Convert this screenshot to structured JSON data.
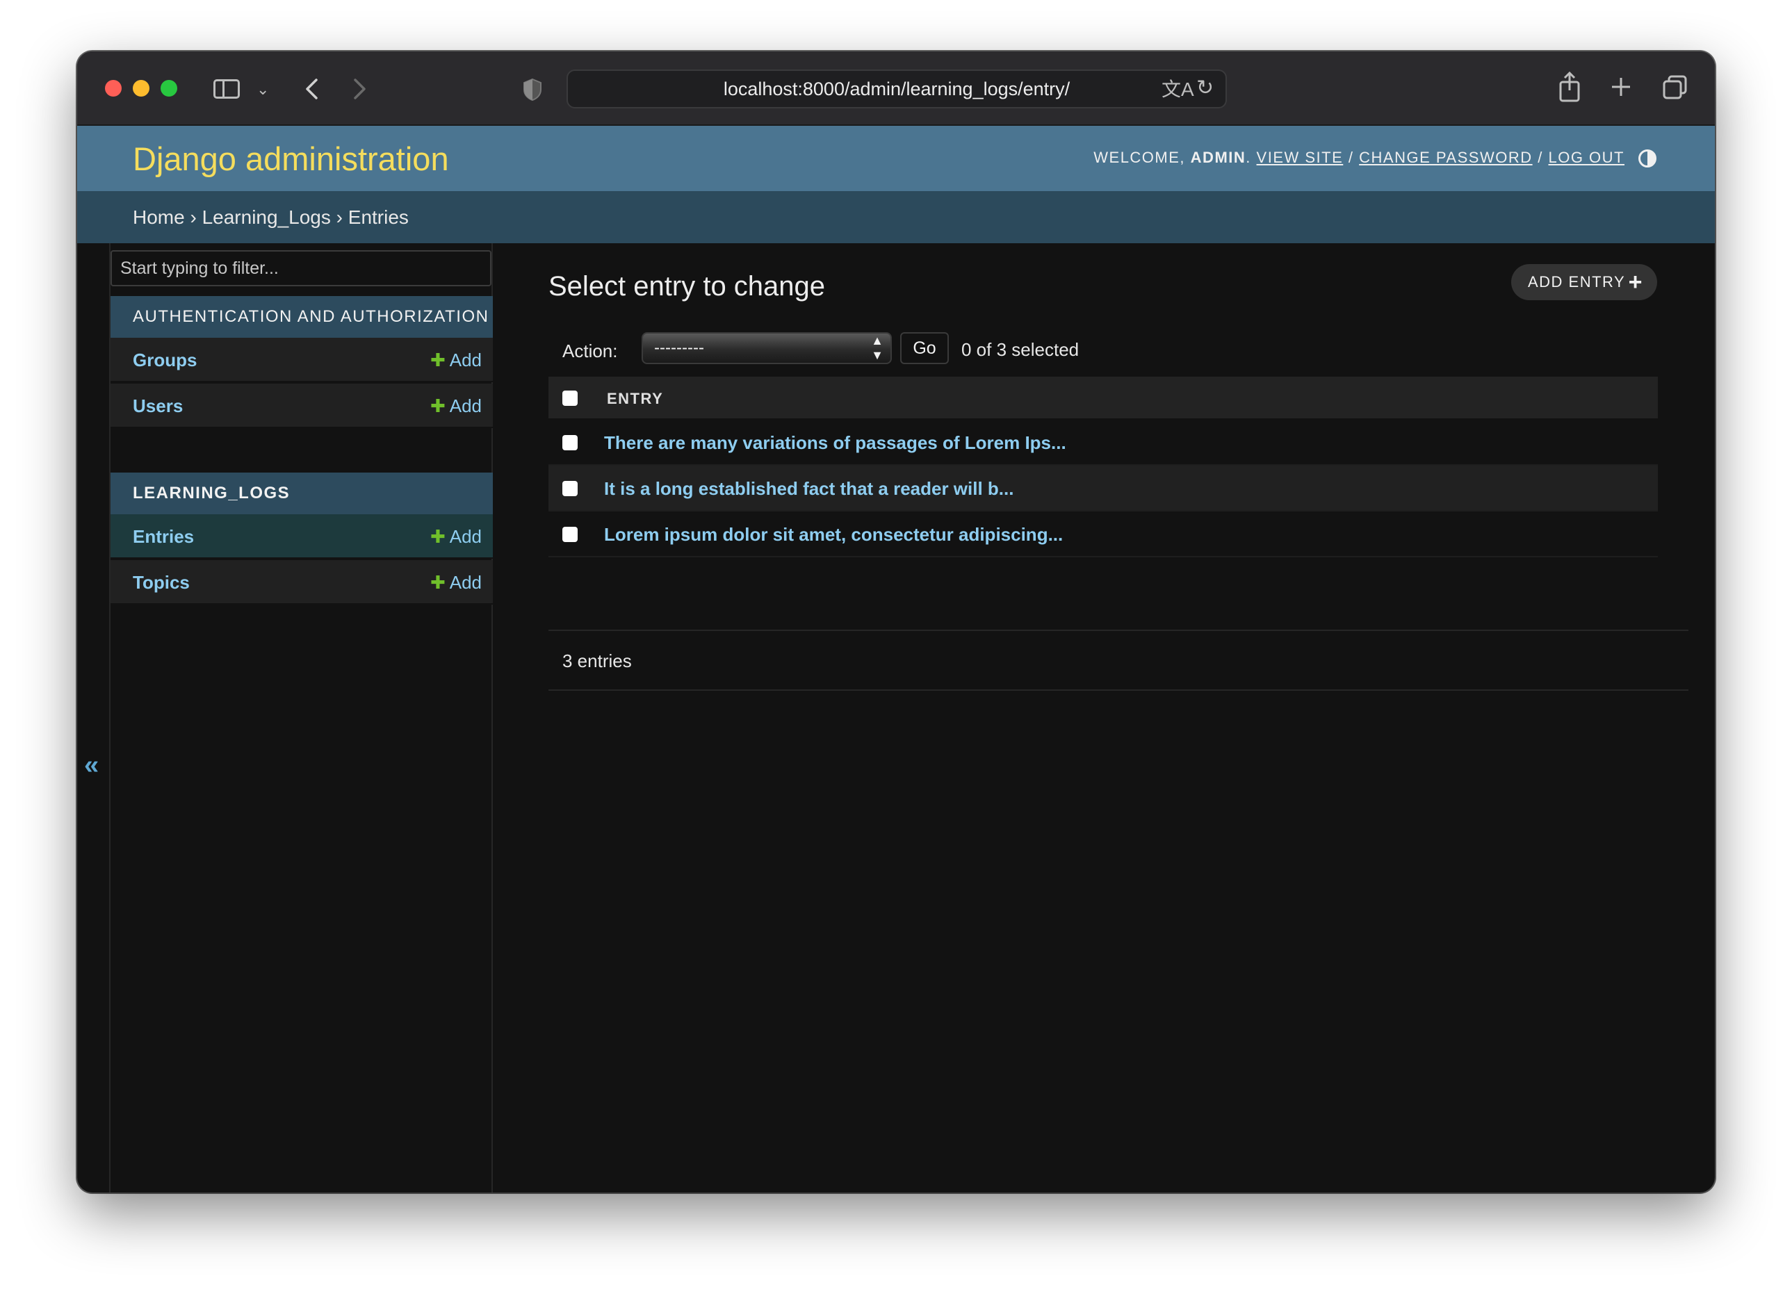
{
  "browser": {
    "url": "localhost:8000/admin/learning_logs/entry/"
  },
  "header": {
    "brand": "Django administration",
    "welcome_prefix": "Welcome,",
    "username": "admin",
    "view_site": "View site",
    "change_password": "Change password",
    "log_out": "Log out",
    "separator": "/"
  },
  "breadcrumbs": {
    "home": "Home",
    "app": "Learning_Logs",
    "current": "Entries",
    "separator": "›"
  },
  "sidebar": {
    "filter_placeholder": "Start typing to filter...",
    "collapse_glyph": "«",
    "modules": [
      {
        "caption": "Authentication and Authorization",
        "models": [
          {
            "name": "Groups",
            "add_label": "Add"
          },
          {
            "name": "Users",
            "add_label": "Add"
          }
        ]
      },
      {
        "caption": "Learning_Logs",
        "models": [
          {
            "name": "Entries",
            "add_label": "Add",
            "selected": true
          },
          {
            "name": "Topics",
            "add_label": "Add"
          }
        ]
      }
    ]
  },
  "main": {
    "title": "Select entry to change",
    "add_button": "Add entry",
    "action_label": "Action:",
    "action_selected": "---------",
    "go_button": "Go",
    "selection_counter": "0 of 3 selected",
    "table": {
      "column": "Entry",
      "rows": [
        "There are many variations of passages of Lorem Ips...",
        "It is a long established fact that a reader will b...",
        "Lorem ipsum dolor sit amet, consectetur adipiscing..."
      ]
    },
    "paginator": "3 entries"
  },
  "colors": {
    "header_bg": "#4b7591",
    "breadcrumb_bg": "#2c4a5c",
    "brand": "#f5dd5d",
    "link": "#8ecdf0",
    "add_plus": "#70bf2b",
    "body_bg": "#121212"
  },
  "icons": {
    "sidebar_toggle": "sidebar-icon",
    "back": "chevron-left-icon",
    "forward": "chevron-right-icon",
    "shield": "shield-icon",
    "translate": "translate-icon",
    "reload": "reload-icon",
    "share": "share-icon",
    "new_tab": "plus-icon",
    "tabs": "tabs-overview-icon",
    "theme": "theme-toggle-icon"
  }
}
